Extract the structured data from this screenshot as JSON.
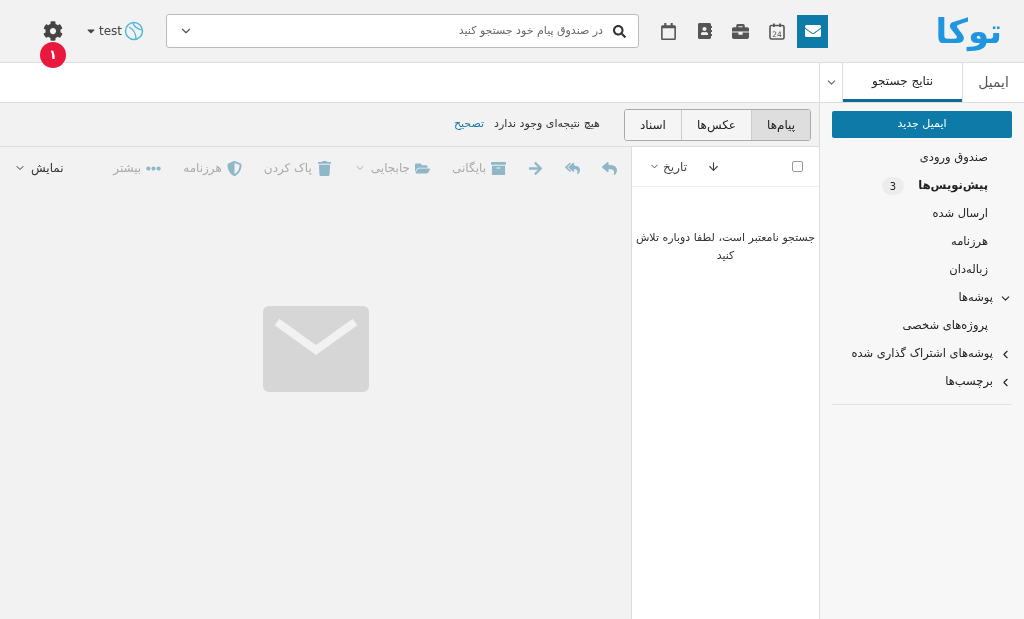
{
  "header": {
    "logo": "توکا",
    "apps": [
      {
        "kind": "mail",
        "selected": true
      },
      {
        "kind": "calendar-day",
        "selected": false
      },
      {
        "kind": "briefcase",
        "selected": false
      },
      {
        "kind": "contacts",
        "selected": false
      },
      {
        "kind": "calendar",
        "selected": false
      }
    ],
    "calendar_day": "24",
    "search": {
      "placeholder": "در صندوق پیام خود جستجو کنید"
    },
    "user": {
      "name": "test"
    },
    "notifications": {
      "count": "۱"
    }
  },
  "tabs": [
    {
      "label": "ایمیل",
      "selected": false
    },
    {
      "label": "نتایج جستجو",
      "selected": true
    }
  ],
  "sidebar": {
    "new_button": "ایمیل جدید",
    "items": [
      {
        "label": "صندوق ورودی",
        "bold": false
      },
      {
        "label": "پیش‌نویس‌ها",
        "bold": true,
        "count": "3"
      },
      {
        "label": "ارسال شده",
        "bold": false
      },
      {
        "label": "هرزنامه",
        "bold": false
      },
      {
        "label": "زباله‌دان",
        "bold": false
      },
      {
        "label": "پوشه‌ها",
        "bold": false,
        "expanded": true,
        "children": [
          {
            "label": "پروژه‌های شخصی",
            "bold": false
          }
        ]
      },
      {
        "label": "پوشه‌های اشتراک گذاری شده",
        "bold": false,
        "expanded": false
      },
      {
        "label": "برچسب‌ها",
        "bold": false,
        "expanded": false
      }
    ]
  },
  "filter_tabs": [
    {
      "label": "پیام‌ها",
      "selected": true
    },
    {
      "label": "عکس‌ها",
      "selected": false
    },
    {
      "label": "اسناد",
      "selected": false
    }
  ],
  "result_message": "هیچ نتیجه‌ای وجود ندارد",
  "correct_link": "تصحیح",
  "list_header": {
    "select_all": false,
    "sort": "تاریخ"
  },
  "list_message": "جستجو نامعتبر است، لطفا دوباره تلاش کنید",
  "toolbar": [
    {
      "kind": "reply",
      "disabled": true,
      "dropdown": false
    },
    {
      "kind": "reply-all",
      "disabled": true,
      "dropdown": false
    },
    {
      "kind": "forward",
      "disabled": true,
      "dropdown": false
    },
    {
      "kind": "archive",
      "label": "بایگانی",
      "disabled": true,
      "dropdown": false
    },
    {
      "kind": "move",
      "label": "جابجایی",
      "disabled": true,
      "dropdown": true
    },
    {
      "kind": "delete",
      "label": "پاک کردن",
      "disabled": true,
      "dropdown": false
    },
    {
      "kind": "spam",
      "label": "هرزنامه",
      "disabled": true,
      "dropdown": false
    },
    {
      "kind": "more",
      "label": "بیشتر",
      "disabled": true,
      "dropdown": false
    },
    {
      "kind": "view",
      "label": "نمایش",
      "disabled": false,
      "dropdown": true
    }
  ]
}
